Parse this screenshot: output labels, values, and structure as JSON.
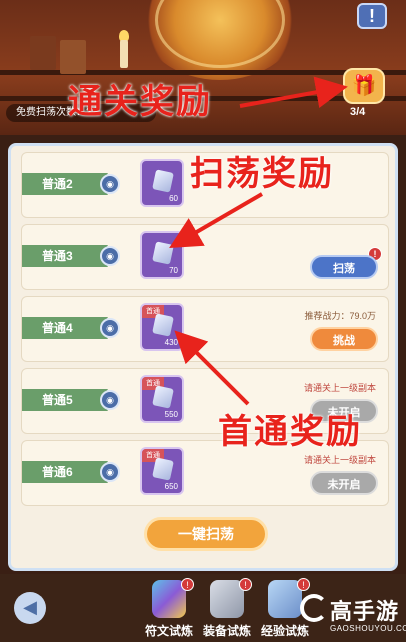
{
  "header": {
    "free_sweep_label": "免费扫荡次数：2",
    "reward_count": "3/4",
    "warn_icon": "!"
  },
  "annotations": {
    "pass_reward": "通关奖励",
    "sweep_reward": "扫荡奖励",
    "first_pass_reward": "首通奖励"
  },
  "rows": [
    {
      "stage": "普通2",
      "item_count": "60",
      "first_tag": "",
      "note": "",
      "button": "",
      "badge": ""
    },
    {
      "stage": "普通3",
      "item_count": "70",
      "first_tag": "",
      "note": "",
      "button": "扫荡",
      "badge": "!"
    },
    {
      "stage": "普通4",
      "item_count": "430",
      "first_tag": "首通",
      "note": "推荐战力：79.0万",
      "button": "挑战",
      "badge": ""
    },
    {
      "stage": "普通5",
      "item_count": "550",
      "first_tag": "首通",
      "note": "请通关上一级副本",
      "button": "未开启",
      "badge": ""
    },
    {
      "stage": "普通6",
      "item_count": "650",
      "first_tag": "首通",
      "note": "请通关上一级副本",
      "button": "未开启",
      "badge": ""
    }
  ],
  "sweep_all_label": "一键扫荡",
  "tabs": [
    {
      "label": "符文试炼",
      "badge": "!",
      "icon": "rune-icon"
    },
    {
      "label": "装备试炼",
      "badge": "!",
      "icon": "sword-icon"
    },
    {
      "label": "经验试炼",
      "badge": "!",
      "icon": "potion-icon"
    }
  ],
  "watermark": {
    "main": "高手游",
    "sub": "GAOSHOUYOU.COM"
  },
  "colors": {
    "annotation": "#e8231c",
    "sweep_button": "#4c74c8",
    "challenge_button": "#ef8a3c",
    "disabled_button": "#a9a9a9"
  }
}
